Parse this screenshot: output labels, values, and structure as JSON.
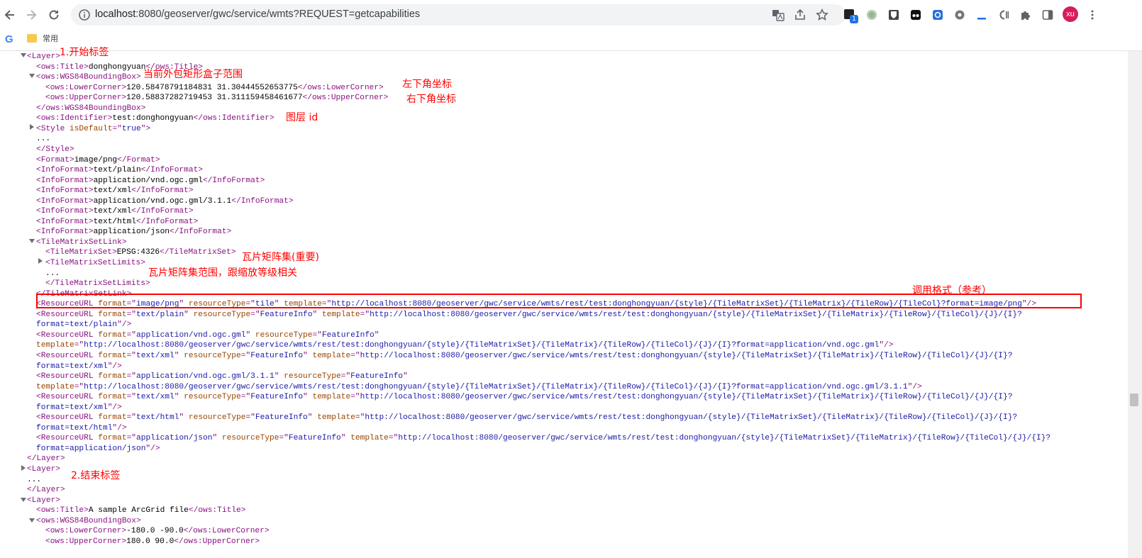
{
  "browser": {
    "url_host": "localhost",
    "url_rest": ":8080/geoserver/gwc/service/wmts?REQUEST=getcapabilities",
    "profile_initials": "xu",
    "extension_badge": "1",
    "bookmark_label": "常用",
    "bookmark_g": "G"
  },
  "xml_lines": [
    {
      "i": 0,
      "h": [
        [
          "t",
          "<Layer>"
        ]
      ]
    },
    {
      "i": 1,
      "h": [
        [
          "t",
          "<ows:Title>"
        ],
        [
          "x",
          "donghongyuan"
        ],
        [
          "t",
          "</ows:Title>"
        ]
      ]
    },
    {
      "i": 1,
      "h": [
        [
          "t",
          "<ows:WGS84BoundingBox>"
        ]
      ]
    },
    {
      "i": 2,
      "h": [
        [
          "t",
          "<ows:LowerCorner>"
        ],
        [
          "x",
          "120.58478791184831 31.30444552653775"
        ],
        [
          "t",
          "</ows:LowerCorner>"
        ]
      ]
    },
    {
      "i": 2,
      "h": [
        [
          "t",
          "<ows:UpperCorner>"
        ],
        [
          "x",
          "120.58837282719453 31.311159458461677"
        ],
        [
          "t",
          "</ows:UpperCorner>"
        ]
      ]
    },
    {
      "i": 1,
      "h": [
        [
          "t",
          "</ows:WGS84BoundingBox>"
        ]
      ]
    },
    {
      "i": 1,
      "h": [
        [
          "t",
          "<ows:Identifier>"
        ],
        [
          "x",
          "test:donghongyuan"
        ],
        [
          "t",
          "</ows:Identifier>"
        ]
      ]
    },
    {
      "i": 1,
      "h": [
        [
          "t",
          "<Style "
        ],
        [
          "an",
          "isDefault"
        ],
        [
          "t",
          "=\""
        ],
        [
          "av",
          "true"
        ],
        [
          "t",
          "\">"
        ]
      ]
    },
    {
      "i": 1,
      "h": [
        [
          "x",
          "..."
        ]
      ]
    },
    {
      "i": 1,
      "h": [
        [
          "t",
          "</Style>"
        ]
      ]
    },
    {
      "i": 1,
      "h": [
        [
          "t",
          "<Format>"
        ],
        [
          "x",
          "image/png"
        ],
        [
          "t",
          "</Format>"
        ]
      ]
    },
    {
      "i": 1,
      "h": [
        [
          "t",
          "<InfoFormat>"
        ],
        [
          "x",
          "text/plain"
        ],
        [
          "t",
          "</InfoFormat>"
        ]
      ]
    },
    {
      "i": 1,
      "h": [
        [
          "t",
          "<InfoFormat>"
        ],
        [
          "x",
          "application/vnd.ogc.gml"
        ],
        [
          "t",
          "</InfoFormat>"
        ]
      ]
    },
    {
      "i": 1,
      "h": [
        [
          "t",
          "<InfoFormat>"
        ],
        [
          "x",
          "text/xml"
        ],
        [
          "t",
          "</InfoFormat>"
        ]
      ]
    },
    {
      "i": 1,
      "h": [
        [
          "t",
          "<InfoFormat>"
        ],
        [
          "x",
          "application/vnd.ogc.gml/3.1.1"
        ],
        [
          "t",
          "</InfoFormat>"
        ]
      ]
    },
    {
      "i": 1,
      "h": [
        [
          "t",
          "<InfoFormat>"
        ],
        [
          "x",
          "text/xml"
        ],
        [
          "t",
          "</InfoFormat>"
        ]
      ]
    },
    {
      "i": 1,
      "h": [
        [
          "t",
          "<InfoFormat>"
        ],
        [
          "x",
          "text/html"
        ],
        [
          "t",
          "</InfoFormat>"
        ]
      ]
    },
    {
      "i": 1,
      "h": [
        [
          "t",
          "<InfoFormat>"
        ],
        [
          "x",
          "application/json"
        ],
        [
          "t",
          "</InfoFormat>"
        ]
      ]
    },
    {
      "i": 1,
      "h": [
        [
          "t",
          "<TileMatrixSetLink>"
        ]
      ]
    },
    {
      "i": 2,
      "h": [
        [
          "t",
          "<TileMatrixSet>"
        ],
        [
          "x",
          "EPSG:4326"
        ],
        [
          "t",
          "</TileMatrixSet>"
        ]
      ]
    },
    {
      "i": 2,
      "h": [
        [
          "t",
          "<TileMatrixSetLimits>"
        ]
      ]
    },
    {
      "i": 2,
      "h": [
        [
          "x",
          "..."
        ]
      ]
    },
    {
      "i": 2,
      "h": [
        [
          "t",
          "</TileMatrixSetLimits>"
        ]
      ]
    },
    {
      "i": 1,
      "h": [
        [
          "t",
          "</TileMatrixSetLink>"
        ]
      ]
    },
    {
      "i": 1,
      "h": [
        [
          "t",
          "<ResourceURL "
        ],
        [
          "an",
          "format"
        ],
        [
          "t",
          "=\""
        ],
        [
          "av",
          "image/png"
        ],
        [
          "t",
          "\" "
        ],
        [
          "an",
          "resourceType"
        ],
        [
          "t",
          "=\""
        ],
        [
          "av",
          "tile"
        ],
        [
          "t",
          "\" "
        ],
        [
          "an",
          "template"
        ],
        [
          "t",
          "=\""
        ],
        [
          "av",
          "http://localhost:8080/geoserver/gwc/service/wmts/rest/test:donghongyuan/{style}/{TileMatrixSet}/{TileMatrix}/{TileRow}/{TileCol}?format=image/png"
        ],
        [
          "t",
          "\"/>"
        ]
      ]
    },
    {
      "i": 1,
      "h": [
        [
          "t",
          "<ResourceURL "
        ],
        [
          "an",
          "format"
        ],
        [
          "t",
          "=\""
        ],
        [
          "av",
          "text/plain"
        ],
        [
          "t",
          "\" "
        ],
        [
          "an",
          "resourceType"
        ],
        [
          "t",
          "=\""
        ],
        [
          "av",
          "FeatureInfo"
        ],
        [
          "t",
          "\" "
        ],
        [
          "an",
          "template"
        ],
        [
          "t",
          "=\""
        ],
        [
          "av",
          "http://localhost:8080/geoserver/gwc/service/wmts/rest/test:donghongyuan/{style}/{TileMatrixSet}/{TileMatrix}/{TileRow}/{TileCol}/{J}/{I}?"
        ]
      ]
    },
    {
      "i": 1,
      "h": [
        [
          "av",
          "format=text/plain"
        ],
        [
          "t",
          "\"/>"
        ]
      ]
    },
    {
      "i": 1,
      "h": [
        [
          "t",
          "<ResourceURL "
        ],
        [
          "an",
          "format"
        ],
        [
          "t",
          "=\""
        ],
        [
          "av",
          "application/vnd.ogc.gml"
        ],
        [
          "t",
          "\" "
        ],
        [
          "an",
          "resourceType"
        ],
        [
          "t",
          "=\""
        ],
        [
          "av",
          "FeatureInfo"
        ],
        [
          "t",
          "\""
        ]
      ]
    },
    {
      "i": 1,
      "h": [
        [
          "an",
          "template"
        ],
        [
          "t",
          "=\""
        ],
        [
          "av",
          "http://localhost:8080/geoserver/gwc/service/wmts/rest/test:donghongyuan/{style}/{TileMatrixSet}/{TileMatrix}/{TileRow}/{TileCol}/{J}/{I}?format=application/vnd.ogc.gml"
        ],
        [
          "t",
          "\"/>"
        ]
      ]
    },
    {
      "i": 1,
      "h": [
        [
          "t",
          "<ResourceURL "
        ],
        [
          "an",
          "format"
        ],
        [
          "t",
          "=\""
        ],
        [
          "av",
          "text/xml"
        ],
        [
          "t",
          "\" "
        ],
        [
          "an",
          "resourceType"
        ],
        [
          "t",
          "=\""
        ],
        [
          "av",
          "FeatureInfo"
        ],
        [
          "t",
          "\" "
        ],
        [
          "an",
          "template"
        ],
        [
          "t",
          "=\""
        ],
        [
          "av",
          "http://localhost:8080/geoserver/gwc/service/wmts/rest/test:donghongyuan/{style}/{TileMatrixSet}/{TileMatrix}/{TileRow}/{TileCol}/{J}/{I}?"
        ]
      ]
    },
    {
      "i": 1,
      "h": [
        [
          "av",
          "format=text/xml"
        ],
        [
          "t",
          "\"/>"
        ]
      ]
    },
    {
      "i": 1,
      "h": [
        [
          "t",
          "<ResourceURL "
        ],
        [
          "an",
          "format"
        ],
        [
          "t",
          "=\""
        ],
        [
          "av",
          "application/vnd.ogc.gml/3.1.1"
        ],
        [
          "t",
          "\" "
        ],
        [
          "an",
          "resourceType"
        ],
        [
          "t",
          "=\""
        ],
        [
          "av",
          "FeatureInfo"
        ],
        [
          "t",
          "\""
        ]
      ]
    },
    {
      "i": 1,
      "h": [
        [
          "an",
          "template"
        ],
        [
          "t",
          "=\""
        ],
        [
          "av",
          "http://localhost:8080/geoserver/gwc/service/wmts/rest/test:donghongyuan/{style}/{TileMatrixSet}/{TileMatrix}/{TileRow}/{TileCol}/{J}/{I}?format=application/vnd.ogc.gml/3.1.1"
        ],
        [
          "t",
          "\"/>"
        ]
      ]
    },
    {
      "i": 1,
      "h": [
        [
          "t",
          "<ResourceURL "
        ],
        [
          "an",
          "format"
        ],
        [
          "t",
          "=\""
        ],
        [
          "av",
          "text/xml"
        ],
        [
          "t",
          "\" "
        ],
        [
          "an",
          "resourceType"
        ],
        [
          "t",
          "=\""
        ],
        [
          "av",
          "FeatureInfo"
        ],
        [
          "t",
          "\" "
        ],
        [
          "an",
          "template"
        ],
        [
          "t",
          "=\""
        ],
        [
          "av",
          "http://localhost:8080/geoserver/gwc/service/wmts/rest/test:donghongyuan/{style}/{TileMatrixSet}/{TileMatrix}/{TileRow}/{TileCol}/{J}/{I}?"
        ]
      ]
    },
    {
      "i": 1,
      "h": [
        [
          "av",
          "format=text/xml"
        ],
        [
          "t",
          "\"/>"
        ]
      ]
    },
    {
      "i": 1,
      "h": [
        [
          "t",
          "<ResourceURL "
        ],
        [
          "an",
          "format"
        ],
        [
          "t",
          "=\""
        ],
        [
          "av",
          "text/html"
        ],
        [
          "t",
          "\" "
        ],
        [
          "an",
          "resourceType"
        ],
        [
          "t",
          "=\""
        ],
        [
          "av",
          "FeatureInfo"
        ],
        [
          "t",
          "\" "
        ],
        [
          "an",
          "template"
        ],
        [
          "t",
          "=\""
        ],
        [
          "av",
          "http://localhost:8080/geoserver/gwc/service/wmts/rest/test:donghongyuan/{style}/{TileMatrixSet}/{TileMatrix}/{TileRow}/{TileCol}/{J}/{I}?"
        ]
      ]
    },
    {
      "i": 1,
      "h": [
        [
          "av",
          "format=text/html"
        ],
        [
          "t",
          "\"/>"
        ]
      ]
    },
    {
      "i": 1,
      "h": [
        [
          "t",
          "<ResourceURL "
        ],
        [
          "an",
          "format"
        ],
        [
          "t",
          "=\""
        ],
        [
          "av",
          "application/json"
        ],
        [
          "t",
          "\" "
        ],
        [
          "an",
          "resourceType"
        ],
        [
          "t",
          "=\""
        ],
        [
          "av",
          "FeatureInfo"
        ],
        [
          "t",
          "\" "
        ],
        [
          "an",
          "template"
        ],
        [
          "t",
          "=\""
        ],
        [
          "av",
          "http://localhost:8080/geoserver/gwc/service/wmts/rest/test:donghongyuan/{style}/{TileMatrixSet}/{TileMatrix}/{TileRow}/{TileCol}/{J}/{I}?"
        ]
      ]
    },
    {
      "i": 1,
      "h": [
        [
          "av",
          "format=application/json"
        ],
        [
          "t",
          "\"/>"
        ]
      ]
    },
    {
      "i": 0,
      "h": [
        [
          "t",
          "</Layer>"
        ]
      ]
    },
    {
      "i": 0,
      "h": [
        [
          "t",
          "<Layer>"
        ]
      ]
    },
    {
      "i": 0,
      "h": [
        [
          "x",
          "..."
        ]
      ]
    },
    {
      "i": 0,
      "h": [
        [
          "t",
          "</Layer>"
        ]
      ]
    },
    {
      "i": 0,
      "h": [
        [
          "t",
          "<Layer>"
        ]
      ]
    },
    {
      "i": 1,
      "h": [
        [
          "t",
          "<ows:Title>"
        ],
        [
          "x",
          "A sample ArcGrid file"
        ],
        [
          "t",
          "</ows:Title>"
        ]
      ]
    },
    {
      "i": 1,
      "h": [
        [
          "t",
          "<ows:WGS84BoundingBox>"
        ]
      ]
    },
    {
      "i": 2,
      "h": [
        [
          "t",
          "<ows:LowerCorner>"
        ],
        [
          "x",
          "-180.0 -90.0"
        ],
        [
          "t",
          "</ows:LowerCorner>"
        ]
      ]
    },
    {
      "i": 2,
      "h": [
        [
          "t",
          "<ows:UpperCorner>"
        ],
        [
          "x",
          "180.0 90.0"
        ],
        [
          "t",
          "</ows:UpperCorner>"
        ]
      ]
    }
  ],
  "annotations": {
    "start_tag": "1.开始标签",
    "bbox_range": "当前外包矩形盒子范围",
    "lower_left": "左下角坐标",
    "upper_right": "右下角坐标",
    "layer_id": "图层 id",
    "tile_matrix_set": "瓦片矩阵集(重要)",
    "tile_matrix_limits": "瓦片矩阵集范围，跟缩放等级相关",
    "call_format": "调用格式（参考）",
    "end_tag": "2.结束标签"
  },
  "colors": {
    "tag": "#881280",
    "attr_name": "#994500",
    "attr_value": "#1a1aa6",
    "annotation": "#ff0000"
  }
}
